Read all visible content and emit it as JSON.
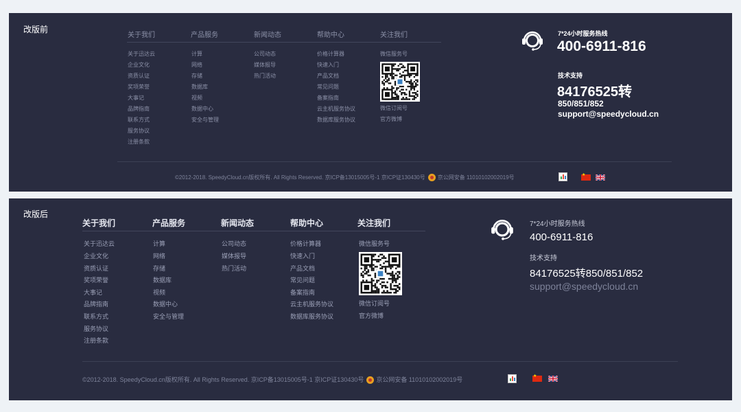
{
  "before": {
    "tag": "改版前",
    "columns": [
      {
        "title": "关于我们",
        "items": [
          "关于迅达云",
          "企业文化",
          "资质认证",
          "奖项荣誉",
          "大事记",
          "品牌指南",
          "联系方式",
          "服务协议",
          "注册条款"
        ]
      },
      {
        "title": "产品服务",
        "items": [
          "计算",
          "网络",
          "存储",
          "数据库",
          "视频",
          "数据中心",
          "安全与管理"
        ]
      },
      {
        "title": "新闻动态",
        "items": [
          "公司动态",
          "媒体报导",
          "热门活动"
        ]
      },
      {
        "title": "帮助中心",
        "items": [
          "价格计算器",
          "快速入门",
          "产品文档",
          "常见问题",
          "备案指南",
          "云主机服务协议",
          "数据库服务协议"
        ]
      },
      {
        "title": "关注我们",
        "items_top": [
          "微信服务号"
        ],
        "items_bottom": [
          "微信订阅号",
          "官方微博"
        ]
      }
    ],
    "contact": {
      "hotline_label": "7*24小时服务热线",
      "hotline": "400-6911-816",
      "support_label": "技术支持",
      "support_phone": "84176525转",
      "support_ext": "850/851/852",
      "email": "support@speedycloud.cn"
    },
    "copyright": "©2012-2018. SpeedyCloud.cn版权所有. All Rights Reserved. 京ICP备13015005号-1 京ICP证130430号",
    "police": "京公网安备 11010102002019号"
  },
  "after": {
    "tag": "改版后",
    "columns": [
      {
        "title": "关于我们",
        "items": [
          "关于迅达云",
          "企业文化",
          "资质认证",
          "奖项荣誉",
          "大事记",
          "品牌指南",
          "联系方式",
          "服务协议",
          "注册条款"
        ]
      },
      {
        "title": "产品服务",
        "items": [
          "计算",
          "网络",
          "存储",
          "数据库",
          "视频",
          "数据中心",
          "安全与管理"
        ]
      },
      {
        "title": "新闻动态",
        "items": [
          "公司动态",
          "媒体报导",
          "热门活动"
        ]
      },
      {
        "title": "帮助中心",
        "items": [
          "价格计算器",
          "快速入门",
          "产品文档",
          "常见问题",
          "备案指南",
          "云主机服务协议",
          "数据库服务协议"
        ]
      },
      {
        "title": "关注我们",
        "items_top": [
          "微信服务号"
        ],
        "items_bottom": [
          "微信订阅号",
          "官方微博"
        ]
      }
    ],
    "contact": {
      "hotline_label": "7*24小时服务热线",
      "hotline": "400-6911-816",
      "support_label": "技术支持",
      "support_phone": "84176525转850/851/852",
      "email": "support@speedycloud.cn"
    },
    "copyright": "©2012-2018. SpeedyCloud.cn版权所有. All Rights Reserved. 京ICP备13015005号-1 京ICP证130430号",
    "police": "京公网安备 11010102002019号"
  },
  "icons": [
    "headset-icon",
    "qr-code",
    "police-badge-icon",
    "stats-icon",
    "china-flag-icon",
    "uk-flag-icon"
  ],
  "colors": {
    "background": "#292c40",
    "page": "#eef2f6",
    "title_after": "#e4e6ee",
    "muted": "#8a8fa6"
  }
}
